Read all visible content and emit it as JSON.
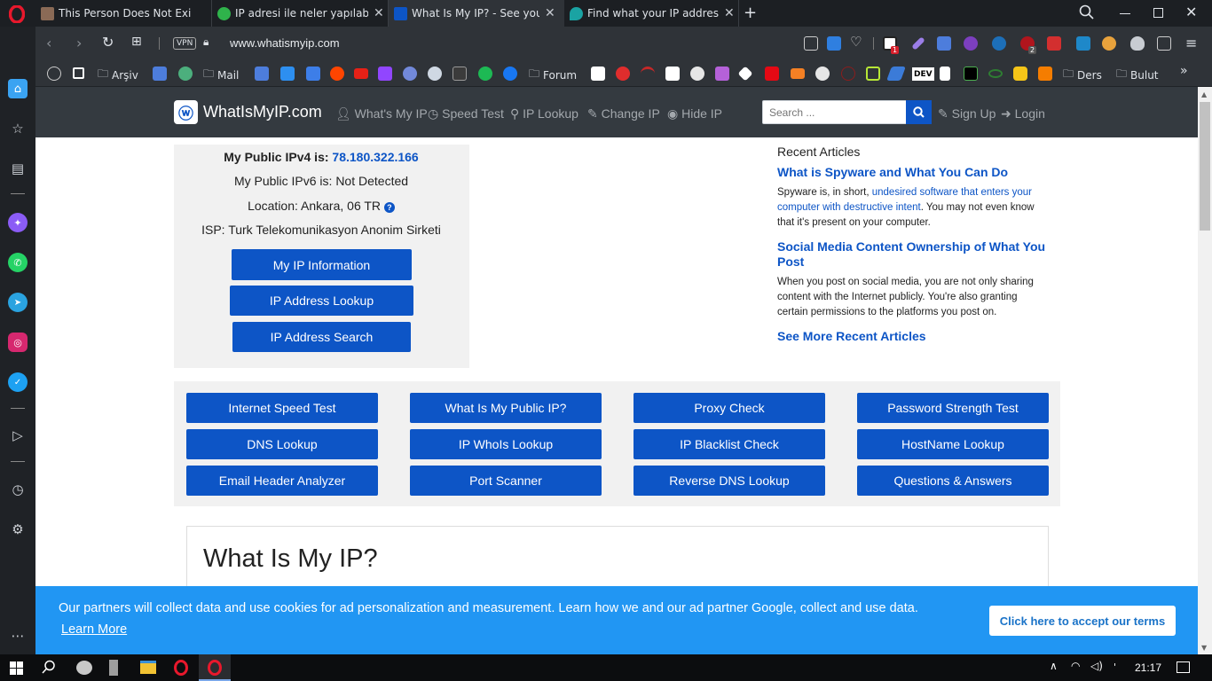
{
  "tabs": [
    {
      "title": "This Person Does Not Exist",
      "color": "#8a6a56"
    },
    {
      "title": "IP adresi ile neler yapılabilir?",
      "color": "#2fb34b"
    },
    {
      "title": "What Is My IP? - See your public IP",
      "color": "#0d55c6"
    },
    {
      "title": "Find what your IP address is",
      "color": "#1aa3a3"
    }
  ],
  "addressbar": {
    "vpn_label": "VPN",
    "url": "www.whatismyip.com"
  },
  "bookmarks": {
    "arsiv": "Arşiv",
    "mail": "Mail",
    "forum": "Forum",
    "dev": "DEV",
    "ders": "Ders",
    "bulut": "Bulut",
    "more": "»"
  },
  "extension_badges": {
    "adblock": "1",
    "ublock": "2"
  },
  "site": {
    "logo": "WhatIsMyIP.com",
    "nav": [
      "What's My IP",
      "Speed Test",
      "IP Lookup",
      "Change IP",
      "Hide IP"
    ],
    "search_placeholder": "Search ...",
    "signup": "Sign Up",
    "login": "Login"
  },
  "ipinfo": {
    "ipv4_label": "My Public IPv4 is:",
    "ipv4_value": "78.180.322.166",
    "ipv6": "My Public IPv6 is: Not Detected",
    "location": "Location: Ankara, 06 TR",
    "isp": "ISP: Turk Telekomunikasyon Anonim Sirketi",
    "buttons": [
      "My IP Information",
      "IP Address Lookup",
      "IP Address Search"
    ]
  },
  "articles": {
    "heading": "Recent Articles",
    "a1_title": "What is Spyware and What You Can Do",
    "a1_pre": "Spyware is, in short, ",
    "a1_link": "undesired software that enters your computer with destructive intent",
    "a1_post": ". You may not even know that it's present on your computer.",
    "a2_title": "Social Media Content Ownership of What You Post",
    "a2_text": "When you post on social media, you are not only sharing content with the Internet publicly. You're also granting certain permissions to the platforms you post on.",
    "more": "See More Recent Articles"
  },
  "tools": [
    [
      "Internet Speed Test",
      "What Is My Public IP?",
      "Proxy Check",
      "Password Strength Test"
    ],
    [
      "DNS Lookup",
      "IP WhoIs Lookup",
      "IP Blacklist Check",
      "HostName Lookup"
    ],
    [
      "Email Header Analyzer",
      "Port Scanner",
      "Reverse DNS Lookup",
      "Questions & Answers"
    ]
  ],
  "main_heading": "What Is My IP?",
  "cookie": {
    "text": "Our partners will collect data and use cookies for ad personalization and measurement. Learn how we and our ad partner Google, collect and use data.",
    "learn_more": "Learn More",
    "accept": "Click here to accept our terms"
  },
  "taskbar": {
    "time": "21:17",
    "lang": "'"
  }
}
